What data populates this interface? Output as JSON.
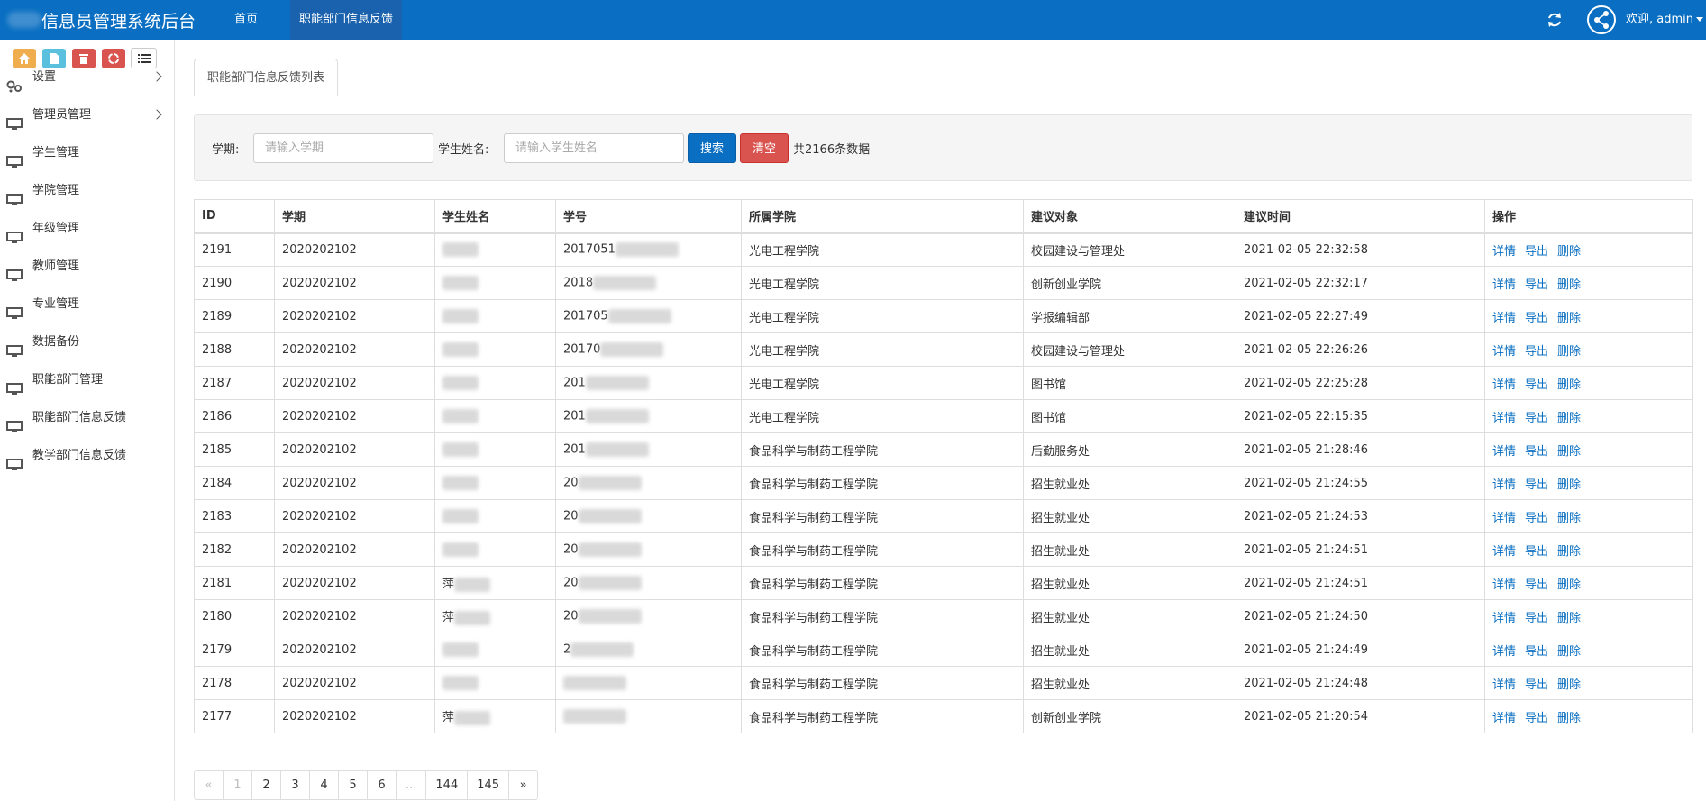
{
  "header": {
    "title": "信息员管理系统后台",
    "nav": [
      {
        "label": "首页",
        "active": false
      },
      {
        "label": "职能部门信息反馈",
        "active": true
      }
    ],
    "user_label": "欢迎, admin"
  },
  "sidebar": {
    "shortcuts": [
      {
        "icon": "home-icon",
        "color": "#f0ad4e"
      },
      {
        "icon": "file-icon",
        "color": "#5bc0de"
      },
      {
        "icon": "trash-icon",
        "color": "#d9534f"
      },
      {
        "icon": "recycle-icon",
        "color": "#d9534f"
      },
      {
        "icon": "list-icon",
        "color": "#ffffff"
      }
    ],
    "items": [
      {
        "label": "设置",
        "icon": "gears-icon",
        "expandable": true
      },
      {
        "label": "管理员管理",
        "icon": "monitor-icon",
        "expandable": true
      },
      {
        "label": "学生管理",
        "icon": "monitor-icon",
        "expandable": false
      },
      {
        "label": "学院管理",
        "icon": "monitor-icon",
        "expandable": false
      },
      {
        "label": "年级管理",
        "icon": "monitor-icon",
        "expandable": false
      },
      {
        "label": "教师管理",
        "icon": "monitor-icon",
        "expandable": false
      },
      {
        "label": "专业管理",
        "icon": "monitor-icon",
        "expandable": false
      },
      {
        "label": "数据备份",
        "icon": "monitor-icon",
        "expandable": false
      },
      {
        "label": "职能部门管理",
        "icon": "monitor-icon",
        "expandable": false
      },
      {
        "label": "职能部门信息反馈",
        "icon": "monitor-icon",
        "expandable": false
      },
      {
        "label": "教学部门信息反馈",
        "icon": "monitor-icon",
        "expandable": false
      }
    ]
  },
  "main": {
    "tab_label": "职能部门信息反馈列表",
    "search": {
      "term_label": "学期:",
      "term_placeholder": "请输入学期",
      "name_label": "学生姓名:",
      "name_placeholder": "请输入学生姓名",
      "search_button": "搜索",
      "clear_button": "清空",
      "count_text": "共2166条数据"
    },
    "table": {
      "headers": [
        "ID",
        "学期",
        "学生姓名",
        "学号",
        "所属学院",
        "建议对象",
        "建议时间",
        "操作"
      ],
      "actions": [
        "详情",
        "导出",
        "删除"
      ],
      "rows": [
        {
          "id": "2191",
          "term": "2020202102",
          "name": "",
          "sid": "2017051",
          "college": "光电工程学院",
          "target": "校园建设与管理处",
          "time": "2021-02-05 22:32:58"
        },
        {
          "id": "2190",
          "term": "2020202102",
          "name": "",
          "sid": "2018",
          "college": "光电工程学院",
          "target": "创新创业学院",
          "time": "2021-02-05 22:32:17"
        },
        {
          "id": "2189",
          "term": "2020202102",
          "name": "",
          "sid": "201705",
          "college": "光电工程学院",
          "target": "学报编辑部",
          "time": "2021-02-05 22:27:49"
        },
        {
          "id": "2188",
          "term": "2020202102",
          "name": "",
          "sid": "20170",
          "college": "光电工程学院",
          "target": "校园建设与管理处",
          "time": "2021-02-05 22:26:26"
        },
        {
          "id": "2187",
          "term": "2020202102",
          "name": "",
          "sid": "201",
          "college": "光电工程学院",
          "target": "图书馆",
          "time": "2021-02-05 22:25:28"
        },
        {
          "id": "2186",
          "term": "2020202102",
          "name": "",
          "sid": "201",
          "college": "光电工程学院",
          "target": "图书馆",
          "time": "2021-02-05 22:15:35"
        },
        {
          "id": "2185",
          "term": "2020202102",
          "name": "",
          "sid": "201",
          "college": "食品科学与制药工程学院",
          "target": "后勤服务处",
          "time": "2021-02-05 21:28:46"
        },
        {
          "id": "2184",
          "term": "2020202102",
          "name": "",
          "sid": "20",
          "college": "食品科学与制药工程学院",
          "target": "招生就业处",
          "time": "2021-02-05 21:24:55"
        },
        {
          "id": "2183",
          "term": "2020202102",
          "name": "",
          "sid": "20",
          "college": "食品科学与制药工程学院",
          "target": "招生就业处",
          "time": "2021-02-05 21:24:53"
        },
        {
          "id": "2182",
          "term": "2020202102",
          "name": "",
          "sid": "20",
          "college": "食品科学与制药工程学院",
          "target": "招生就业处",
          "time": "2021-02-05 21:24:51"
        },
        {
          "id": "2181",
          "term": "2020202102",
          "name": "萍",
          "sid": "20",
          "college": "食品科学与制药工程学院",
          "target": "招生就业处",
          "time": "2021-02-05 21:24:51"
        },
        {
          "id": "2180",
          "term": "2020202102",
          "name": "萍",
          "sid": "20",
          "college": "食品科学与制药工程学院",
          "target": "招生就业处",
          "time": "2021-02-05 21:24:50"
        },
        {
          "id": "2179",
          "term": "2020202102",
          "name": "",
          "sid": "2",
          "college": "食品科学与制药工程学院",
          "target": "招生就业处",
          "time": "2021-02-05 21:24:49"
        },
        {
          "id": "2178",
          "term": "2020202102",
          "name": "",
          "sid": "",
          "college": "食品科学与制药工程学院",
          "target": "招生就业处",
          "time": "2021-02-05 21:24:48"
        },
        {
          "id": "2177",
          "term": "2020202102",
          "name": "萍",
          "sid": "",
          "college": "食品科学与制药工程学院",
          "target": "创新创业学院",
          "time": "2021-02-05 21:20:54"
        }
      ]
    },
    "pagination": [
      "«",
      "1",
      "2",
      "3",
      "4",
      "5",
      "6",
      "...",
      "144",
      "145",
      "»"
    ],
    "pagination_current": "1"
  },
  "colors": {
    "navbar": "#0a6fc2",
    "primary": "#0a6fc2",
    "danger": "#d9534f",
    "link": "#0a6fc2"
  }
}
